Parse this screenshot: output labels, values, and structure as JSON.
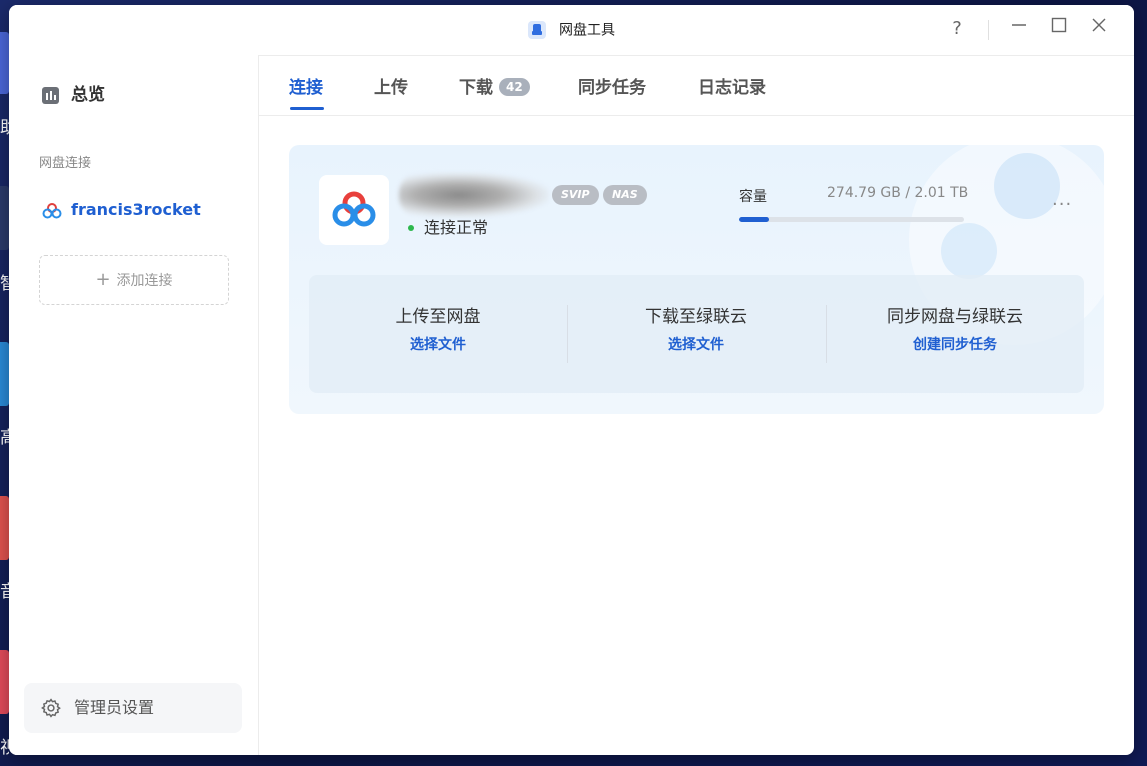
{
  "window": {
    "title": "网盘工具"
  },
  "title_controls": {
    "help_label": "?"
  },
  "sidebar": {
    "overview_label": "总览",
    "section_label": "网盘连接",
    "account_label": "francis3rocket",
    "add_connection_label": "添加连接",
    "admin_settings_label": "管理员设置"
  },
  "tabs": [
    {
      "label": "连接",
      "active": true
    },
    {
      "label": "上传"
    },
    {
      "label": "下载",
      "badge": "42"
    },
    {
      "label": "同步任务"
    },
    {
      "label": "日志记录"
    }
  ],
  "card": {
    "badges": [
      "SVIP",
      "NAS"
    ],
    "status_label": "连接正常",
    "capacity_label": "容量",
    "capacity_value": "274.79 GB / 2.01 TB",
    "capacity_used_fraction": 0.134,
    "more_label": "···",
    "actions": [
      {
        "title": "上传至网盘",
        "link": "选择文件"
      },
      {
        "title": "下载至绿联云",
        "link": "选择文件"
      },
      {
        "title": "同步网盘与绿联云",
        "link": "创建同步任务"
      }
    ]
  },
  "colors": {
    "accent": "#1f5fd1",
    "status_ok": "#2db84d",
    "badge_gray": "#b9bdc4"
  },
  "icons": {
    "app_icon": "cloud-drive-icon",
    "baidu_logo": "baidu-cloud-logo-icon",
    "settings": "gear-icon"
  }
}
